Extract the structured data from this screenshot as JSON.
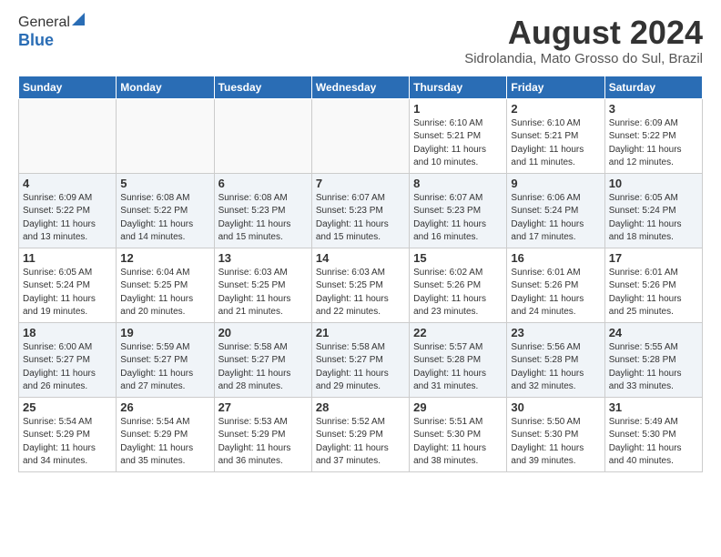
{
  "logo": {
    "general": "General",
    "blue": "Blue"
  },
  "title": "August 2024",
  "subtitle": "Sidrolandia, Mato Grosso do Sul, Brazil",
  "weekdays": [
    "Sunday",
    "Monday",
    "Tuesday",
    "Wednesday",
    "Thursday",
    "Friday",
    "Saturday"
  ],
  "weeks": [
    [
      {
        "day": "",
        "info": ""
      },
      {
        "day": "",
        "info": ""
      },
      {
        "day": "",
        "info": ""
      },
      {
        "day": "",
        "info": ""
      },
      {
        "day": "1",
        "info": "Sunrise: 6:10 AM\nSunset: 5:21 PM\nDaylight: 11 hours\nand 10 minutes."
      },
      {
        "day": "2",
        "info": "Sunrise: 6:10 AM\nSunset: 5:21 PM\nDaylight: 11 hours\nand 11 minutes."
      },
      {
        "day": "3",
        "info": "Sunrise: 6:09 AM\nSunset: 5:22 PM\nDaylight: 11 hours\nand 12 minutes."
      }
    ],
    [
      {
        "day": "4",
        "info": "Sunrise: 6:09 AM\nSunset: 5:22 PM\nDaylight: 11 hours\nand 13 minutes."
      },
      {
        "day": "5",
        "info": "Sunrise: 6:08 AM\nSunset: 5:22 PM\nDaylight: 11 hours\nand 14 minutes."
      },
      {
        "day": "6",
        "info": "Sunrise: 6:08 AM\nSunset: 5:23 PM\nDaylight: 11 hours\nand 15 minutes."
      },
      {
        "day": "7",
        "info": "Sunrise: 6:07 AM\nSunset: 5:23 PM\nDaylight: 11 hours\nand 15 minutes."
      },
      {
        "day": "8",
        "info": "Sunrise: 6:07 AM\nSunset: 5:23 PM\nDaylight: 11 hours\nand 16 minutes."
      },
      {
        "day": "9",
        "info": "Sunrise: 6:06 AM\nSunset: 5:24 PM\nDaylight: 11 hours\nand 17 minutes."
      },
      {
        "day": "10",
        "info": "Sunrise: 6:05 AM\nSunset: 5:24 PM\nDaylight: 11 hours\nand 18 minutes."
      }
    ],
    [
      {
        "day": "11",
        "info": "Sunrise: 6:05 AM\nSunset: 5:24 PM\nDaylight: 11 hours\nand 19 minutes."
      },
      {
        "day": "12",
        "info": "Sunrise: 6:04 AM\nSunset: 5:25 PM\nDaylight: 11 hours\nand 20 minutes."
      },
      {
        "day": "13",
        "info": "Sunrise: 6:03 AM\nSunset: 5:25 PM\nDaylight: 11 hours\nand 21 minutes."
      },
      {
        "day": "14",
        "info": "Sunrise: 6:03 AM\nSunset: 5:25 PM\nDaylight: 11 hours\nand 22 minutes."
      },
      {
        "day": "15",
        "info": "Sunrise: 6:02 AM\nSunset: 5:26 PM\nDaylight: 11 hours\nand 23 minutes."
      },
      {
        "day": "16",
        "info": "Sunrise: 6:01 AM\nSunset: 5:26 PM\nDaylight: 11 hours\nand 24 minutes."
      },
      {
        "day": "17",
        "info": "Sunrise: 6:01 AM\nSunset: 5:26 PM\nDaylight: 11 hours\nand 25 minutes."
      }
    ],
    [
      {
        "day": "18",
        "info": "Sunrise: 6:00 AM\nSunset: 5:27 PM\nDaylight: 11 hours\nand 26 minutes."
      },
      {
        "day": "19",
        "info": "Sunrise: 5:59 AM\nSunset: 5:27 PM\nDaylight: 11 hours\nand 27 minutes."
      },
      {
        "day": "20",
        "info": "Sunrise: 5:58 AM\nSunset: 5:27 PM\nDaylight: 11 hours\nand 28 minutes."
      },
      {
        "day": "21",
        "info": "Sunrise: 5:58 AM\nSunset: 5:27 PM\nDaylight: 11 hours\nand 29 minutes."
      },
      {
        "day": "22",
        "info": "Sunrise: 5:57 AM\nSunset: 5:28 PM\nDaylight: 11 hours\nand 31 minutes."
      },
      {
        "day": "23",
        "info": "Sunrise: 5:56 AM\nSunset: 5:28 PM\nDaylight: 11 hours\nand 32 minutes."
      },
      {
        "day": "24",
        "info": "Sunrise: 5:55 AM\nSunset: 5:28 PM\nDaylight: 11 hours\nand 33 minutes."
      }
    ],
    [
      {
        "day": "25",
        "info": "Sunrise: 5:54 AM\nSunset: 5:29 PM\nDaylight: 11 hours\nand 34 minutes."
      },
      {
        "day": "26",
        "info": "Sunrise: 5:54 AM\nSunset: 5:29 PM\nDaylight: 11 hours\nand 35 minutes."
      },
      {
        "day": "27",
        "info": "Sunrise: 5:53 AM\nSunset: 5:29 PM\nDaylight: 11 hours\nand 36 minutes."
      },
      {
        "day": "28",
        "info": "Sunrise: 5:52 AM\nSunset: 5:29 PM\nDaylight: 11 hours\nand 37 minutes."
      },
      {
        "day": "29",
        "info": "Sunrise: 5:51 AM\nSunset: 5:30 PM\nDaylight: 11 hours\nand 38 minutes."
      },
      {
        "day": "30",
        "info": "Sunrise: 5:50 AM\nSunset: 5:30 PM\nDaylight: 11 hours\nand 39 minutes."
      },
      {
        "day": "31",
        "info": "Sunrise: 5:49 AM\nSunset: 5:30 PM\nDaylight: 11 hours\nand 40 minutes."
      }
    ]
  ]
}
